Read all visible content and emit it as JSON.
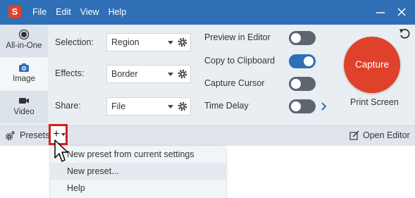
{
  "titlebar": {
    "menu": [
      "File",
      "Edit",
      "View",
      "Help"
    ]
  },
  "modes": [
    {
      "label": "All-in-One",
      "icon": "record-dot-icon"
    },
    {
      "label": "Image",
      "icon": "camera-icon"
    },
    {
      "label": "Video",
      "icon": "video-camera-icon"
    }
  ],
  "settings": {
    "selection": {
      "label": "Selection:",
      "value": "Region"
    },
    "effects": {
      "label": "Effects:",
      "value": "Border"
    },
    "share": {
      "label": "Share:",
      "value": "File"
    }
  },
  "toggles": [
    {
      "label": "Preview in Editor",
      "on": false
    },
    {
      "label": "Copy to Clipboard",
      "on": true
    },
    {
      "label": "Capture Cursor",
      "on": false
    },
    {
      "label": "Time Delay",
      "on": false
    }
  ],
  "capture": {
    "label": "Capture",
    "hotkey": "Print Screen"
  },
  "bottom": {
    "presets_label": "Presets",
    "open_editor_label": "Open Editor"
  },
  "presets_menu": [
    "New preset from current settings",
    "New preset...",
    "Help"
  ],
  "colors": {
    "titlebar": "#2f6fb6",
    "accent": "#2f6fb6",
    "capture": "#e0412a",
    "highlight": "#d22020"
  }
}
